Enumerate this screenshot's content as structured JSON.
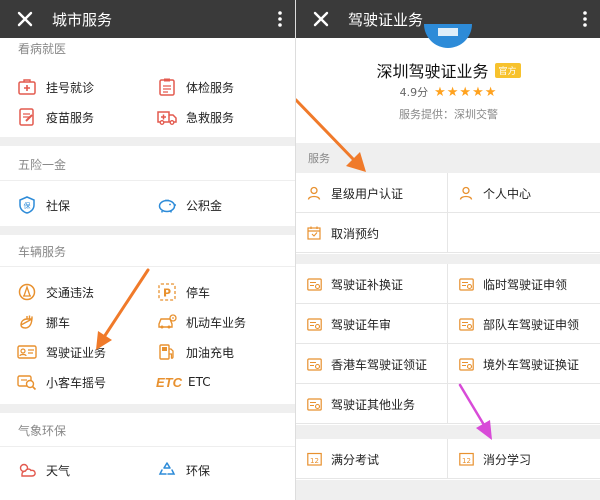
{
  "left": {
    "topbar": {
      "title": "城市服务"
    },
    "sections": {
      "health": {
        "title": "看病就医",
        "items": [
          "挂号就诊",
          "体检服务",
          "疫苗服务",
          "急救服务"
        ]
      },
      "insurance": {
        "title": "五险一金",
        "items": [
          "社保",
          "公积金"
        ]
      },
      "vehicle": {
        "title": "车辆服务",
        "items": [
          "交通违法",
          "停车",
          "挪车",
          "机动车业务",
          "驾驶证业务",
          "加油充电",
          "小客车摇号",
          "ETC"
        ]
      },
      "weather": {
        "title": "气象环保",
        "items": [
          "天气",
          "环保"
        ]
      }
    },
    "etc_glyph": "ETC",
    "parking_glyph": "P"
  },
  "right": {
    "topbar": {
      "title": "驾驶证业务"
    },
    "service": {
      "name": "深圳驾驶证业务",
      "badge": "官方",
      "rating": "4.9分",
      "stars": "★★★★★",
      "provider": "服务提供：深圳交警"
    },
    "section_label": "服务",
    "rows": [
      [
        "星级用户认证",
        "个人中心"
      ],
      [
        "取消预约",
        ""
      ],
      [
        "驾驶证补换证",
        "临时驾驶证申领"
      ],
      [
        "驾驶证年审",
        "部队车驾驶证申领"
      ],
      [
        "香港车驾驶证领证",
        "境外车驾驶证换证"
      ],
      [
        "驾驶证其他业务",
        ""
      ],
      [
        "满分考试",
        "消分学习"
      ]
    ],
    "calendar_glyph": "12"
  },
  "colors": {
    "topbar": "#3a3a3a",
    "icon_orange": "#e8912f",
    "icon_blue": "#2d8bd8",
    "icon_red": "#e35a4f",
    "badge_yellow": "#f7c22d",
    "star": "#ffa21f",
    "arrow_orange": "#f07a2a",
    "arrow_magenta": "#d84bd8"
  }
}
